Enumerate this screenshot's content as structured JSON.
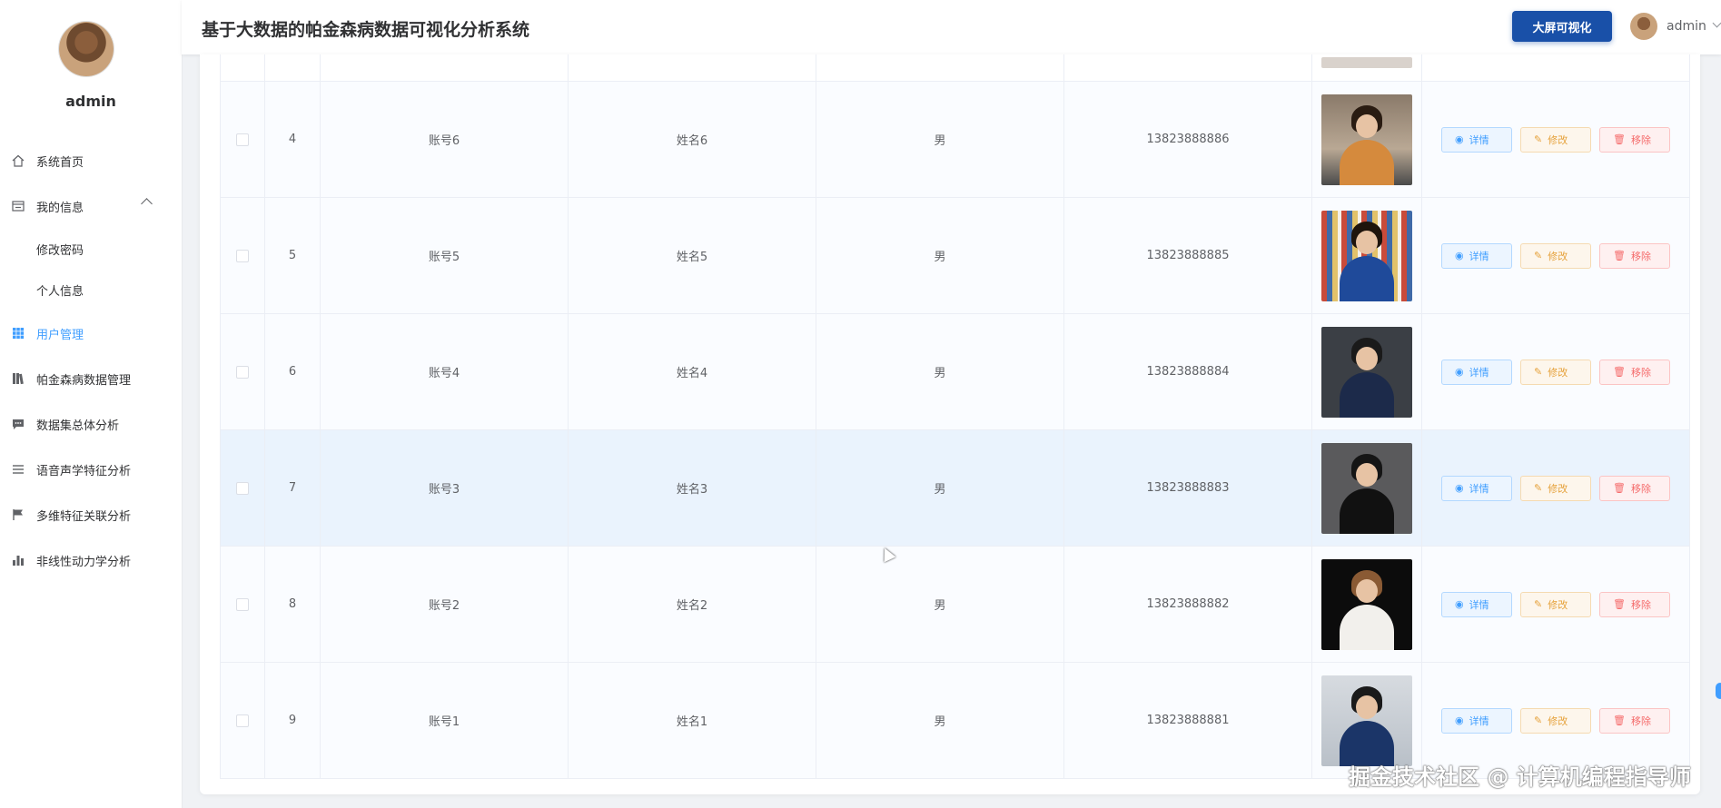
{
  "sidebar": {
    "username": "admin",
    "items": [
      {
        "label": "系统首页",
        "icon": "home-icon"
      },
      {
        "label": "我的信息",
        "icon": "profile-icon"
      },
      {
        "label": "修改密码"
      },
      {
        "label": "个人信息"
      },
      {
        "label": "用户管理",
        "icon": "grid-icon"
      },
      {
        "label": "帕金森病数据管理",
        "icon": "book-icon"
      },
      {
        "label": "数据集总体分析",
        "icon": "chat-icon"
      },
      {
        "label": "语音声学特征分析",
        "icon": "list-icon"
      },
      {
        "label": "多维特征关联分析",
        "icon": "flag-icon"
      },
      {
        "label": "非线性动力学分析",
        "icon": "bar-chart-icon"
      }
    ]
  },
  "header": {
    "title": "基于大数据的帕金森病数据可视化分析系统",
    "bigscreen_label": "大屏可视化",
    "user": "admin"
  },
  "table": {
    "actions": {
      "detail": "详情",
      "edit": "修改",
      "delete": "移除"
    },
    "rows": [
      {
        "index": "4",
        "account": "账号6",
        "name": "姓名6",
        "sex": "男",
        "phone": "13823888886"
      },
      {
        "index": "5",
        "account": "账号5",
        "name": "姓名5",
        "sex": "男",
        "phone": "13823888885"
      },
      {
        "index": "6",
        "account": "账号4",
        "name": "姓名4",
        "sex": "男",
        "phone": "13823888884"
      },
      {
        "index": "7",
        "account": "账号3",
        "name": "姓名3",
        "sex": "男",
        "phone": "13823888883"
      },
      {
        "index": "8",
        "account": "账号2",
        "name": "姓名2",
        "sex": "男",
        "phone": "13823888882"
      },
      {
        "index": "9",
        "account": "账号1",
        "name": "姓名1",
        "sex": "男",
        "phone": "13823888881"
      }
    ]
  },
  "watermark": "掘金技术社区 @ 计算机编程指导师",
  "colors": {
    "accent": "#409eff",
    "bigscreen": "#1950a8",
    "edit": "#e6a23c",
    "delete": "#f56c6c"
  }
}
